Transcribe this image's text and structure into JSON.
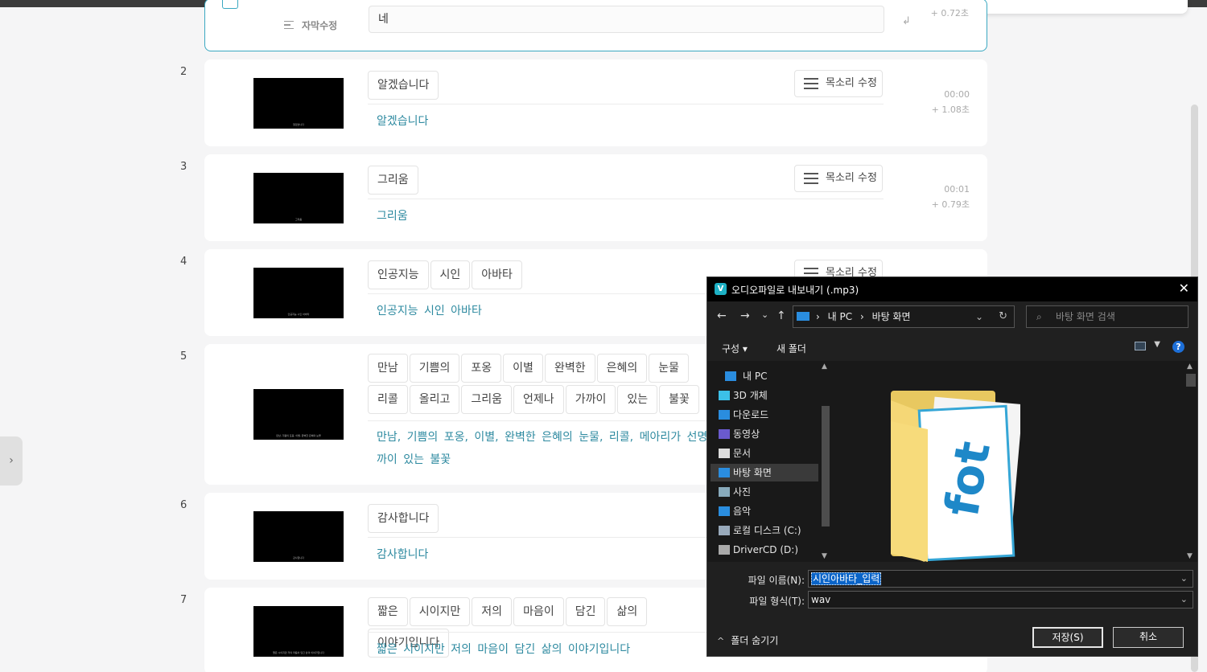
{
  "editor": {
    "row1": {
      "edit_label": "자막수정",
      "input_value": "네",
      "time_delta": "+ 0.72초"
    },
    "rows": [
      {
        "num": "2",
        "chips": [
          "알겠습니다"
        ],
        "subtitle": "알겠습니다",
        "voice_label": "목소리 수정",
        "time": "00:00",
        "delta": "+ 1.08초",
        "thumb_caption": "알겠습니다"
      },
      {
        "num": "3",
        "chips": [
          "그리움"
        ],
        "subtitle": "그리움",
        "voice_label": "목소리 수정",
        "time": "00:01",
        "delta": "+ 0.79초",
        "thumb_caption": "그리움"
      },
      {
        "num": "4",
        "chips": [
          "인공지능",
          "시인",
          "아바타"
        ],
        "subtitle": "인공지능 시인 아바타",
        "voice_label": "목소리 수정",
        "thumb_caption": "인공지능 시인 아바타"
      },
      {
        "num": "5",
        "chips": [
          "만남",
          "기쁨의",
          "포옹",
          "이별",
          "완벽한",
          "은혜의",
          "눈물",
          "리콜",
          "올리고",
          "그리움",
          "언제나",
          "가까이",
          "있는",
          "불꽃"
        ],
        "subtitle": "만남, 기쁨의 포옹, 이별, 완벽한 은혜의 눈물, 리콜, 메아리가 선명 까이 있는 불꽃",
        "thumb_caption": "만남, 기쁨의 포옹, 이별, 완벽한 은혜의 눈물"
      },
      {
        "num": "6",
        "chips": [
          "감사합니다"
        ],
        "subtitle": "감사합니다",
        "thumb_caption": "감사합니다"
      },
      {
        "num": "7",
        "chips": [
          "짧은",
          "시이지만",
          "저의",
          "마음이",
          "담긴",
          "삶의",
          "이야기입니다"
        ],
        "subtitle": "짧은 시이지만 저의 마음이 담긴 삶의 이야기입니다",
        "thumb_caption": "짧은 시이지만 저의 마음이 담긴 삶의 이야기입니다"
      }
    ]
  },
  "side_handle": "›",
  "dialog": {
    "app_icon": "V",
    "title": "오디오파일로 내보내기 (.mp3)",
    "close": "✕",
    "nav": {
      "back": "←",
      "forward": "→",
      "recent": "⌄",
      "up": "↑"
    },
    "address": {
      "pc": "내 PC",
      "sep": "›",
      "folder": "바탕 화면",
      "dropdown": "⌄",
      "refresh": "↻"
    },
    "search_placeholder": "바탕 화면 검색",
    "toolbar": {
      "organize": "구성 ▾",
      "new_folder": "새 폴더",
      "help": "?"
    },
    "tree": [
      "내 PC",
      "3D 개체",
      "다운로드",
      "동영상",
      "문서",
      "바탕 화면",
      "사진",
      "음악",
      "로컬 디스크 (C:)",
      "DriverCD (D:)"
    ],
    "filename_label": "파일 이름(N):",
    "filename_value": "시인아바타_입력",
    "filetype_label": "파일 형식(T):",
    "filetype_value": "wav",
    "hide_folders": "폴더 숨기기",
    "save_button": "저장(S)",
    "cancel_button": "취소"
  }
}
